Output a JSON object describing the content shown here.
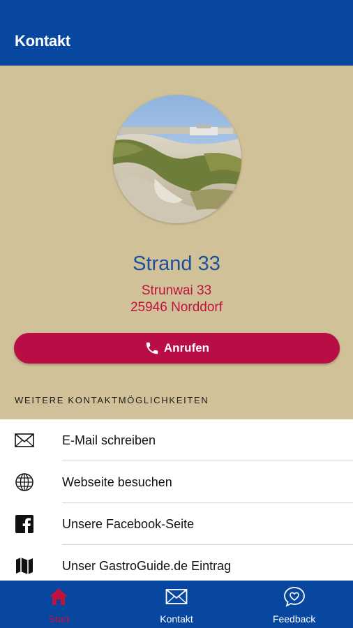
{
  "header": {
    "title": "Kontakt"
  },
  "venue": {
    "name": "Strand 33",
    "address_line1": "Strunwai 33",
    "address_line2": "25946 Norddorf",
    "photo_icon": "beach-dune-photo"
  },
  "call_button": {
    "label": "Anrufen",
    "icon": "phone-icon"
  },
  "more_contacts": {
    "heading": "WEITERE KONTAKTMÖGLICHKEITEN",
    "items": [
      {
        "label": "E-Mail schreiben",
        "icon": "mail-icon"
      },
      {
        "label": "Webseite besuchen",
        "icon": "globe-icon"
      },
      {
        "label": "Unsere Facebook-Seite",
        "icon": "facebook-icon"
      },
      {
        "label": "Unser GastroGuide.de Eintrag",
        "icon": "map-icon"
      }
    ]
  },
  "tabbar": {
    "tabs": [
      {
        "label": "Start",
        "icon": "home-icon",
        "active": true
      },
      {
        "label": "Kontakt",
        "icon": "mail-icon",
        "active": false
      },
      {
        "label": "Feedback",
        "icon": "heart-speech-icon",
        "active": false
      }
    ]
  },
  "colors": {
    "brand_blue": "#0747a0",
    "accent_red": "#b80d45",
    "sand_background": "#d1c199",
    "venue_name_blue": "#1d4f9a"
  }
}
